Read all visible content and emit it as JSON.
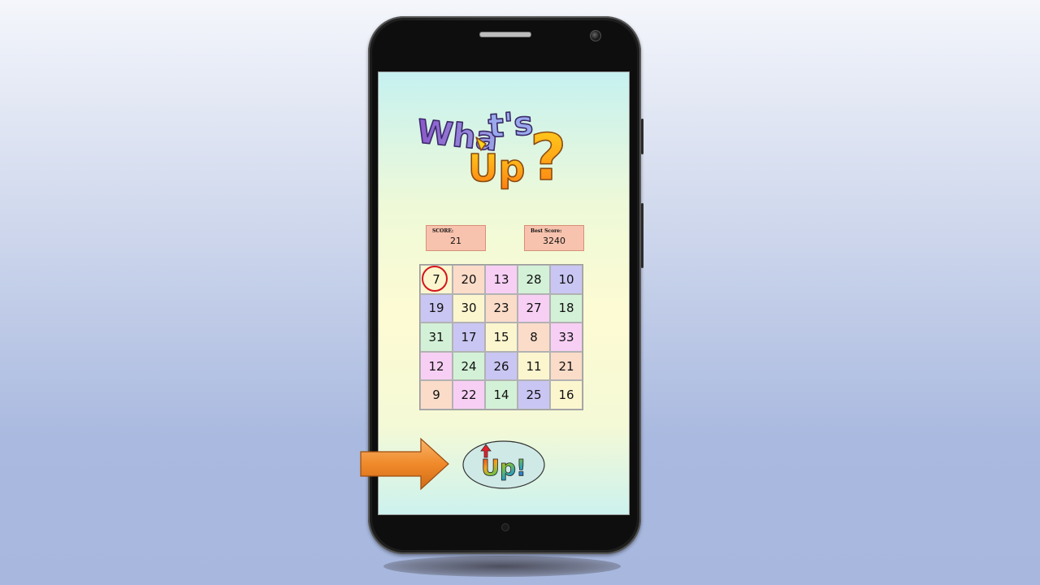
{
  "game": {
    "title_logo": "What's Up?",
    "score": {
      "label": "SCORE:",
      "value": "21"
    },
    "best_score": {
      "label": "Best Score:",
      "value": "3240"
    },
    "selected_number": 7,
    "grid": [
      [
        {
          "n": "7",
          "color": "#fcf6cf"
        },
        {
          "n": "20",
          "color": "#fbdcc9"
        },
        {
          "n": "13",
          "color": "#f7cff4"
        },
        {
          "n": "28",
          "color": "#d3f1d7"
        },
        {
          "n": "10",
          "color": "#c9c6f3"
        }
      ],
      [
        {
          "n": "19",
          "color": "#c9c6f3"
        },
        {
          "n": "30",
          "color": "#fcf6cf"
        },
        {
          "n": "23",
          "color": "#fbdcc9"
        },
        {
          "n": "27",
          "color": "#f7cff4"
        },
        {
          "n": "18",
          "color": "#d3f1d7"
        }
      ],
      [
        {
          "n": "31",
          "color": "#d3f1d7"
        },
        {
          "n": "17",
          "color": "#c9c6f3"
        },
        {
          "n": "15",
          "color": "#fcf6cf"
        },
        {
          "n": "8",
          "color": "#fbdcc9"
        },
        {
          "n": "33",
          "color": "#f7cff4"
        }
      ],
      [
        {
          "n": "12",
          "color": "#f7cff4"
        },
        {
          "n": "24",
          "color": "#d3f1d7"
        },
        {
          "n": "26",
          "color": "#c9c6f3"
        },
        {
          "n": "11",
          "color": "#fcf6cf"
        },
        {
          "n": "21",
          "color": "#fbdcc9"
        }
      ],
      [
        {
          "n": "9",
          "color": "#fbdcc9"
        },
        {
          "n": "22",
          "color": "#f7cff4"
        },
        {
          "n": "14",
          "color": "#d3f1d7"
        },
        {
          "n": "25",
          "color": "#c9c6f3"
        },
        {
          "n": "16",
          "color": "#fcf6cf"
        }
      ]
    ],
    "up_button_label": "Up!"
  },
  "colors": {
    "selection_ring": "#d3161c",
    "score_box": "#f8c3ae",
    "pointer_arrow": "#f08a2a"
  },
  "icons": {
    "pointer": "right-arrow-icon",
    "up": "up-arrow-icon"
  }
}
